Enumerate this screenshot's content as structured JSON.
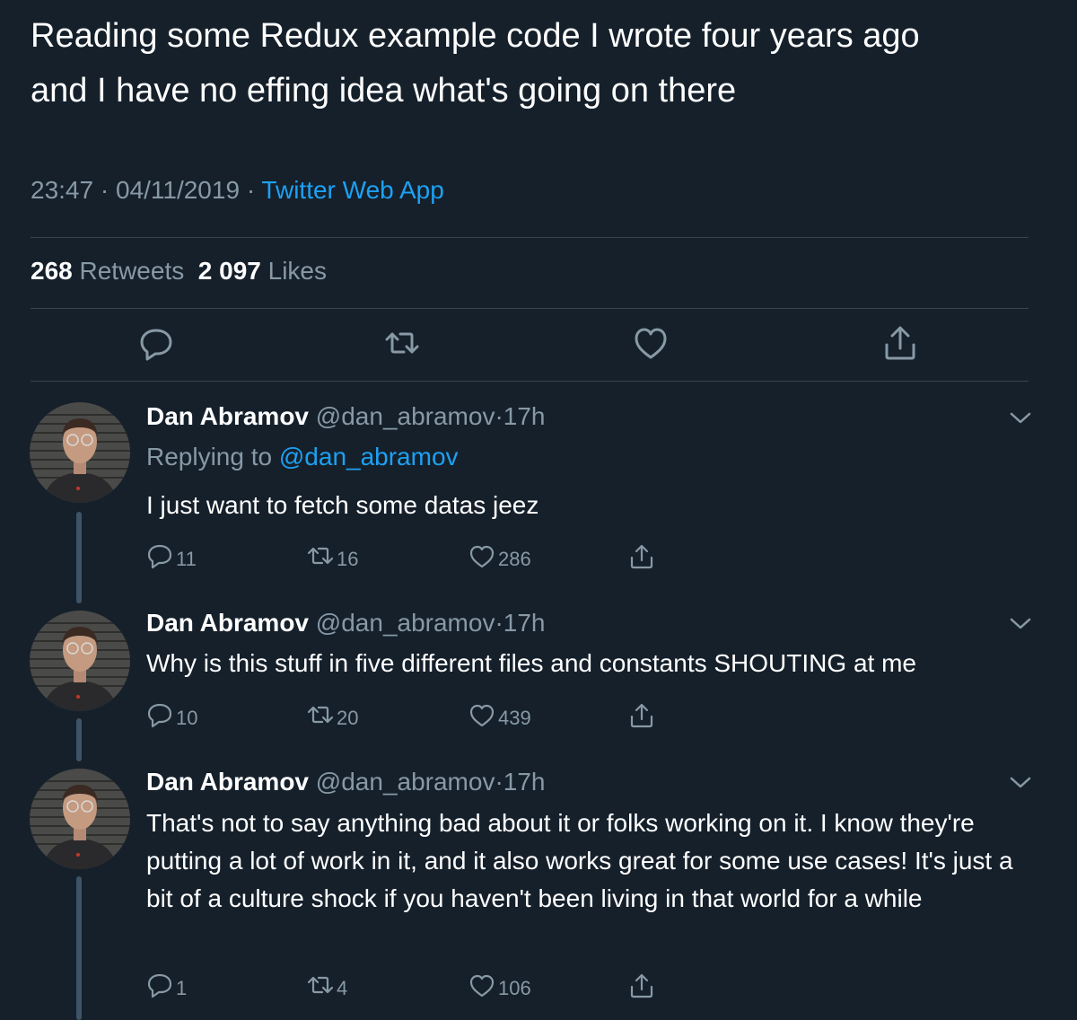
{
  "tweet": {
    "text": "Reading some Redux example code I wrote four years ago\nand I have no effing idea what's going on there",
    "time": "23:47",
    "date": "04/11/2019",
    "separator": "·",
    "source": "Twitter Web App",
    "retweets_count": "268",
    "retweets_label": "Retweets",
    "likes_count": "2 097",
    "likes_label": "Likes"
  },
  "colors": {
    "background": "#15202b",
    "text": "#ffffff",
    "secondary": "#8899a6",
    "accent": "#1da1f2",
    "divider": "#38444d"
  },
  "icons": {
    "reply": "reply-icon",
    "retweet": "retweet-icon",
    "like": "heart-icon",
    "share": "share-icon",
    "menu": "chevron-down-icon"
  },
  "replies": [
    {
      "name": "Dan Abramov",
      "handle": "@dan_abramov",
      "dot": "·",
      "age": "17h",
      "replying_label": "Replying to",
      "replying_to": "@dan_abramov",
      "text": "I just want to fetch some datas jeez",
      "reply_count": "11",
      "retweet_count": "16",
      "like_count": "286"
    },
    {
      "name": "Dan Abramov",
      "handle": "@dan_abramov",
      "dot": "·",
      "age": "17h",
      "text": "Why is this stuff in five different files and constants SHOUTING at me",
      "reply_count": "10",
      "retweet_count": "20",
      "like_count": "439"
    },
    {
      "name": "Dan Abramov",
      "handle": "@dan_abramov",
      "dot": "·",
      "age": "17h",
      "text": "That's not to say anything bad about it or folks working on it. I know they're putting a lot of work in it, and it also works great for some use cases! It's just a bit of a culture shock if you haven't been living in that world for a while",
      "reply_count": "1",
      "retweet_count": "4",
      "like_count": "106"
    }
  ]
}
